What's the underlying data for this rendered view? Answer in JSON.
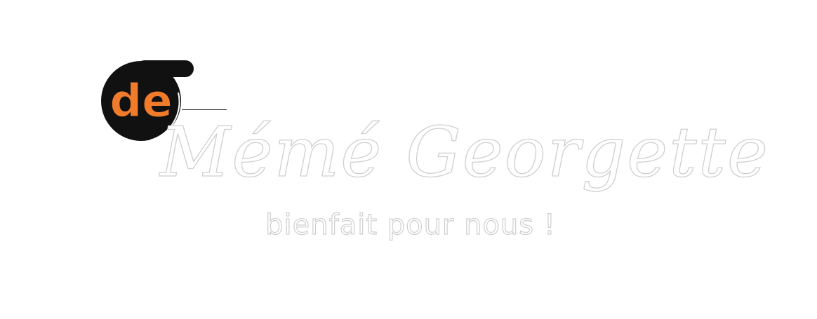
{
  "logo": {
    "badge_text": "de",
    "title": "Mémé Georgette",
    "tagline": "bienfait pour nous !",
    "colors": {
      "badge_bg": "#111111",
      "badge_text": "#f07c2b",
      "outline": "#cfcfcf",
      "fill": "#ffffff"
    }
  }
}
